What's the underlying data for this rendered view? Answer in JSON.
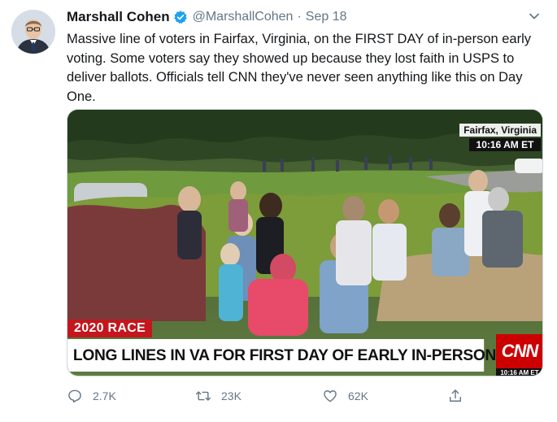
{
  "tweet": {
    "author_name": "Marshall Cohen",
    "handle": "@MarshallCohen",
    "separator": "·",
    "date": "Sep 18",
    "verified": true,
    "text": "Massive line of voters in Fairfax, Virginia, on the FIRST DAY of in-person early voting. Some voters say they showed up because they lost faith in USPS to deliver ballots. Officials tell CNN they've never seen anything like this on Day One."
  },
  "media": {
    "location": "Fairfax, Virginia",
    "time": "10:16 AM ET",
    "race_tag": "2020 RACE",
    "chyron": "LONG LINES IN VA FOR FIRST DAY OF EARLY IN-PERSON VOTING",
    "network_logo": "CNN",
    "logo_time": "10:16 AM ET"
  },
  "actions": {
    "reply_count": "2.7K",
    "retweet_count": "23K",
    "like_count": "62K"
  },
  "colors": {
    "verified_blue": "#1da1f2",
    "secondary_text": "#657786",
    "cnn_red": "#cc0000"
  },
  "icons": [
    "reply-icon",
    "retweet-icon",
    "like-icon",
    "share-icon",
    "chevron-down-icon",
    "verified-badge-icon"
  ]
}
